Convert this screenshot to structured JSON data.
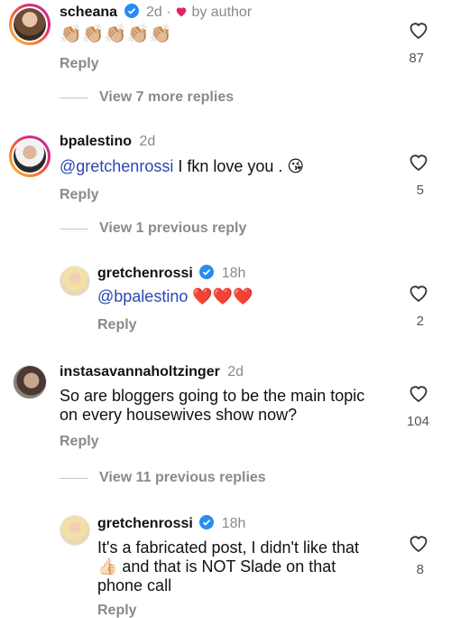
{
  "colors": {
    "mention": "#2b46b6",
    "heart_red": "#e0245e",
    "verified": "#2a8cf0",
    "muted": "#8a8a8a"
  },
  "comments": [
    {
      "username": "scheana",
      "verified": true,
      "time": "2d",
      "by_author": "by author",
      "text": "👏🏼👏🏼👏🏼👏🏼👏🏼",
      "reply": "Reply",
      "likes": "87"
    },
    {
      "username": "bpalestino",
      "verified": false,
      "time": "2d",
      "mention": "@gretchenrossi",
      "text": " I  fkn love you . 😘",
      "reply": "Reply",
      "likes": "5"
    },
    {
      "username": "gretchenrossi",
      "verified": true,
      "time": "18h",
      "mention": "@bpalestino",
      "text": " ❤️❤️❤️",
      "reply": "Reply",
      "likes": "2"
    },
    {
      "username": "instasavannaholtzinger",
      "verified": false,
      "time": "2d",
      "text_line1": "So are bloggers going to be the main topic",
      "text_line2": "on every housewives show now?",
      "reply": "Reply",
      "likes": "104"
    },
    {
      "username": "gretchenrossi",
      "verified": true,
      "time": "18h",
      "text_line1": "It's a fabricated post, I didn't like that",
      "text_line2": "👍🏻 and that is NOT Slade on that",
      "text_line3": "phone call",
      "reply": "Reply",
      "likes": "8"
    }
  ],
  "view_more": [
    "View 7 more replies",
    "View 1 previous reply",
    "View 11 previous replies"
  ]
}
